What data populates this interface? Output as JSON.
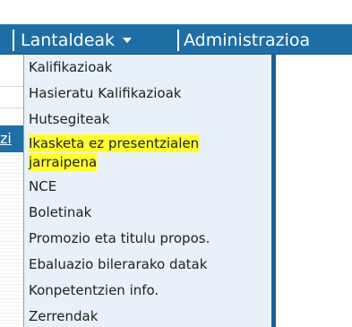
{
  "navbar": {
    "partial_left_label": "",
    "items": [
      {
        "label": "Lantaldeak"
      },
      {
        "label": "Administrazioa"
      }
    ]
  },
  "left_panel": {
    "tab_fragment": "zi"
  },
  "dropdown": {
    "items": [
      {
        "label": "Kalifikazioak"
      },
      {
        "label": "Hasieratu Kalifikazioak"
      },
      {
        "label": "Hutsegiteak"
      },
      {
        "label_line1": "Ikasketa ez presentzialen",
        "label_line2": "jarraipena",
        "highlighted": true,
        "highlight_color": "#ffff2e"
      },
      {
        "label": "NCE"
      },
      {
        "label": "Boletinak"
      },
      {
        "label": "Promozio eta titulu propos."
      },
      {
        "label": "Ebaluazio bilerarako datak"
      },
      {
        "label": "Konpetentzien info."
      },
      {
        "label": "Zerrendak"
      }
    ]
  },
  "colors": {
    "navbar_bg": "#1f6ea5",
    "dropdown_bg": "#e8f1fa",
    "dropdown_border": "#1f5f90",
    "highlight": "#ffff2e"
  }
}
